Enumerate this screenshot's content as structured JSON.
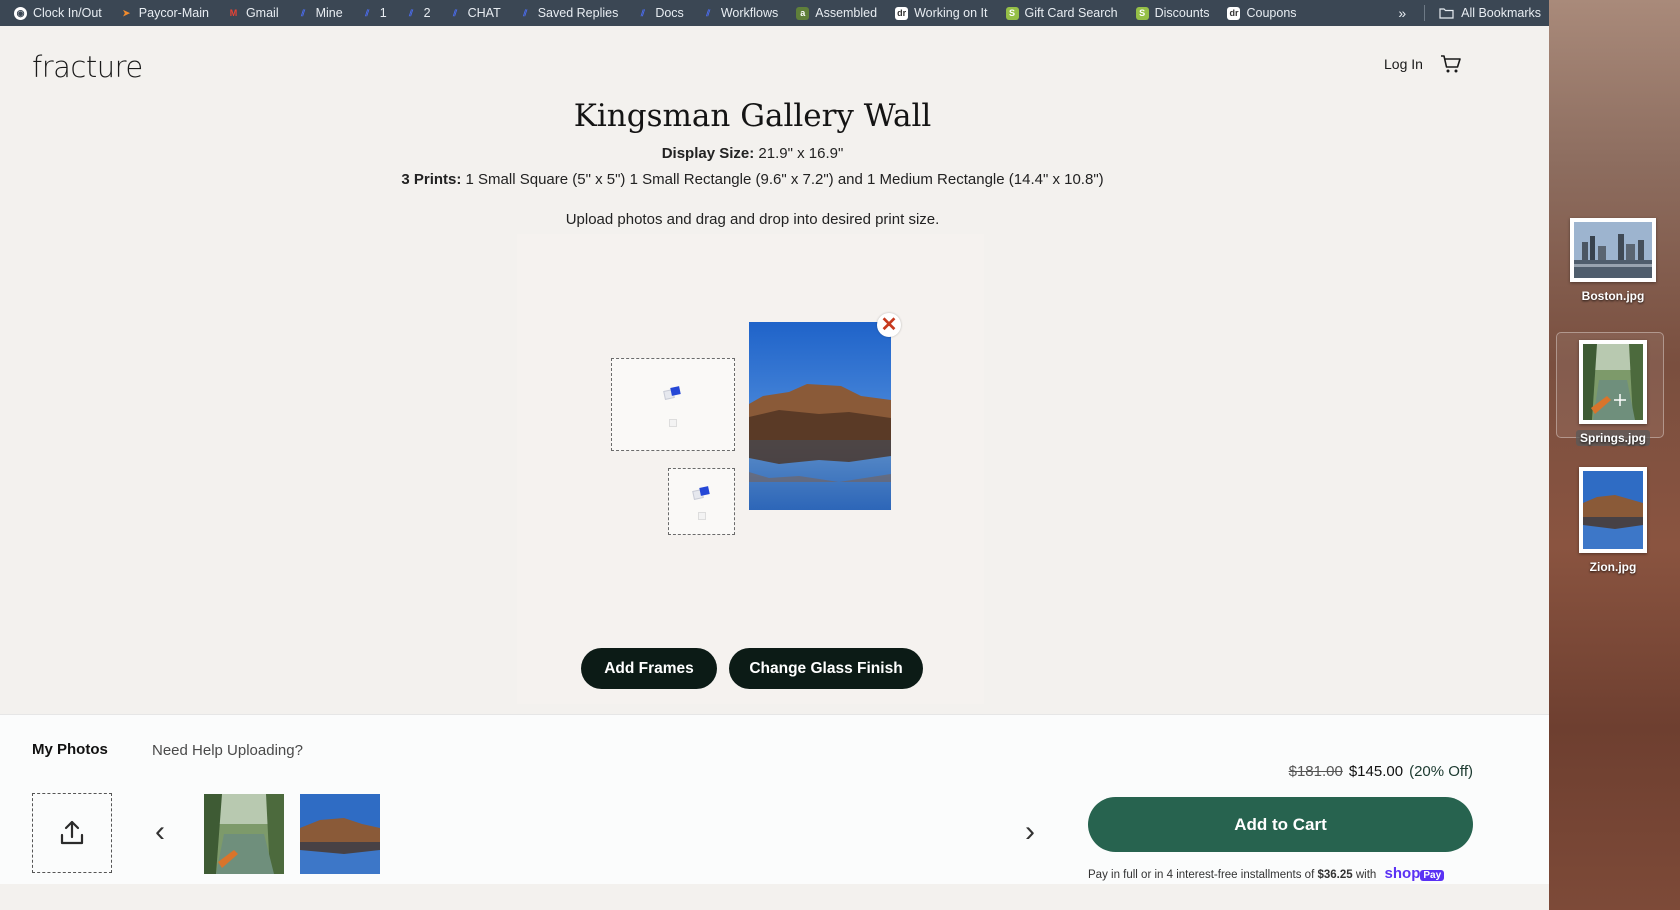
{
  "bookmarks": {
    "items": [
      {
        "label": "Clock In/Out",
        "icon": "clock-globe-icon",
        "color": "#ffffff"
      },
      {
        "label": "Paycor-Main",
        "icon": "paycor-icon",
        "color": "#f28b2d"
      },
      {
        "label": "Gmail",
        "icon": "gmail-icon",
        "color": "#ea4335"
      },
      {
        "label": "Mine",
        "icon": "zendesk-icon",
        "color": "#3b5bdb"
      },
      {
        "label": "1",
        "icon": "zendesk-icon",
        "color": "#3b5bdb"
      },
      {
        "label": "2",
        "icon": "zendesk-icon",
        "color": "#3b5bdb"
      },
      {
        "label": "CHAT",
        "icon": "zendesk-icon",
        "color": "#3b5bdb"
      },
      {
        "label": "Saved Replies",
        "icon": "zendesk-icon",
        "color": "#3b5bdb"
      },
      {
        "label": "Docs",
        "icon": "zendesk-icon",
        "color": "#3b5bdb"
      },
      {
        "label": "Workflows",
        "icon": "zendesk-icon",
        "color": "#3b5bdb"
      },
      {
        "label": "Assembled",
        "icon": "assembled-icon",
        "color": "#6b8e23"
      },
      {
        "label": "Working on It",
        "icon": "fracture-icon",
        "color": "#ffffff"
      },
      {
        "label": "Gift Card Search",
        "icon": "shopify-icon",
        "color": "#95bf47"
      },
      {
        "label": "Discounts",
        "icon": "shopify-icon",
        "color": "#95bf47"
      },
      {
        "label": "Coupons",
        "icon": "fracture-icon",
        "color": "#ffffff"
      }
    ],
    "more": "»",
    "all_bookmarks": "All Bookmarks"
  },
  "header": {
    "logo": "fracture",
    "login": "Log In"
  },
  "product": {
    "title": "Kingsman Gallery Wall",
    "display_size_label": "Display Size:",
    "display_size_value": "21.9\" x 16.9\"",
    "prints_label": "3 Prints:",
    "prints_value": "1 Small Square (5\" x 5\") 1 Small Rectangle (9.6\" x 7.2\") and 1 Medium Rectangle (14.4\" x 10.8\")",
    "instructions": "Upload photos and drag and drop into desired print size."
  },
  "actions": {
    "add_frames": "Add Frames",
    "change_glass": "Change Glass Finish",
    "remove": "✕"
  },
  "bottom": {
    "my_photos": "My Photos",
    "help": "Need Help Uploading?",
    "prev": "‹",
    "next": "›",
    "price_old": "$181.00",
    "price_new": "$145.00",
    "discount": "(20% Off)",
    "add_to_cart": "Add to Cart",
    "installments_prefix": "Pay in full or in 4 interest-free installments of",
    "installment_amount": "$36.25",
    "installments_with": "with",
    "shop": "shop",
    "pay": "Pay"
  },
  "desktop": {
    "files": [
      {
        "label": "Boston.jpg"
      },
      {
        "label": "Springs.jpg"
      },
      {
        "label": "Zion.jpg"
      }
    ]
  },
  "colors": {
    "accent_green": "#27634f",
    "dark_button": "#0c1b16",
    "remove_red": "#c73a1f",
    "shop_purple": "#5a31f4"
  }
}
